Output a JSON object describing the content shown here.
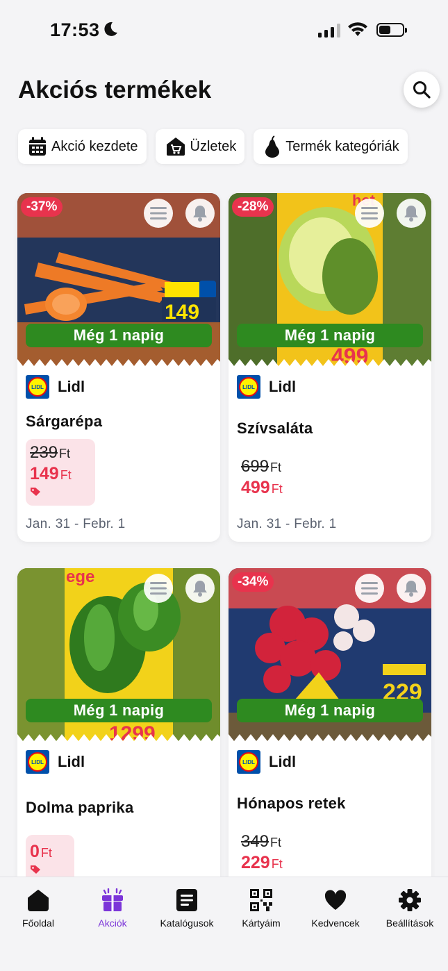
{
  "status_bar": {
    "time": "17:53"
  },
  "header": {
    "title": "Akciós termékek"
  },
  "filters": [
    {
      "label": "Akció kezdete",
      "icon": "calendar-icon"
    },
    {
      "label": "Üzletek",
      "icon": "store-icon"
    },
    {
      "label": "Termék kategóriák",
      "icon": "pear-icon"
    }
  ],
  "products": [
    {
      "discount": "-37%",
      "ribbon": "Még 1 napig",
      "store": "Lidl",
      "name": "Sárgarépa",
      "old_price": "239",
      "new_price": "149",
      "currency": "Ft",
      "dates": "Jan. 31 - Febr. 1"
    },
    {
      "discount": "-28%",
      "ribbon": "Még 1 napig",
      "store": "Lidl",
      "name": "Szívsaláta",
      "old_price": "699",
      "new_price": "499",
      "currency": "Ft",
      "dates": "Jan. 31 - Febr. 1"
    },
    {
      "discount": "",
      "ribbon": "Még 1 napig",
      "store": "Lidl",
      "name": "Dolma paprika",
      "old_price": "",
      "new_price": "0",
      "currency": "Ft",
      "dates": ""
    },
    {
      "discount": "-34%",
      "ribbon": "Még 1 napig",
      "store": "Lidl",
      "name": "Hónapos retek",
      "old_price": "349",
      "new_price": "229",
      "currency": "Ft",
      "dates": ""
    }
  ],
  "tabs": [
    {
      "label": "Főoldal",
      "icon": "home-icon"
    },
    {
      "label": "Akciók",
      "icon": "gift-icon",
      "active": true
    },
    {
      "label": "Katalógusok",
      "icon": "document-icon"
    },
    {
      "label": "Kártyáim",
      "icon": "qr-code-icon"
    },
    {
      "label": "Kedvencek",
      "icon": "heart-icon"
    },
    {
      "label": "Beállítások",
      "icon": "gear-icon"
    }
  ],
  "colors": {
    "accent": "#7b35d8",
    "discount": "#e8334d",
    "ribbon": "#2e8a20",
    "price_bg": "#fbe3e8"
  }
}
